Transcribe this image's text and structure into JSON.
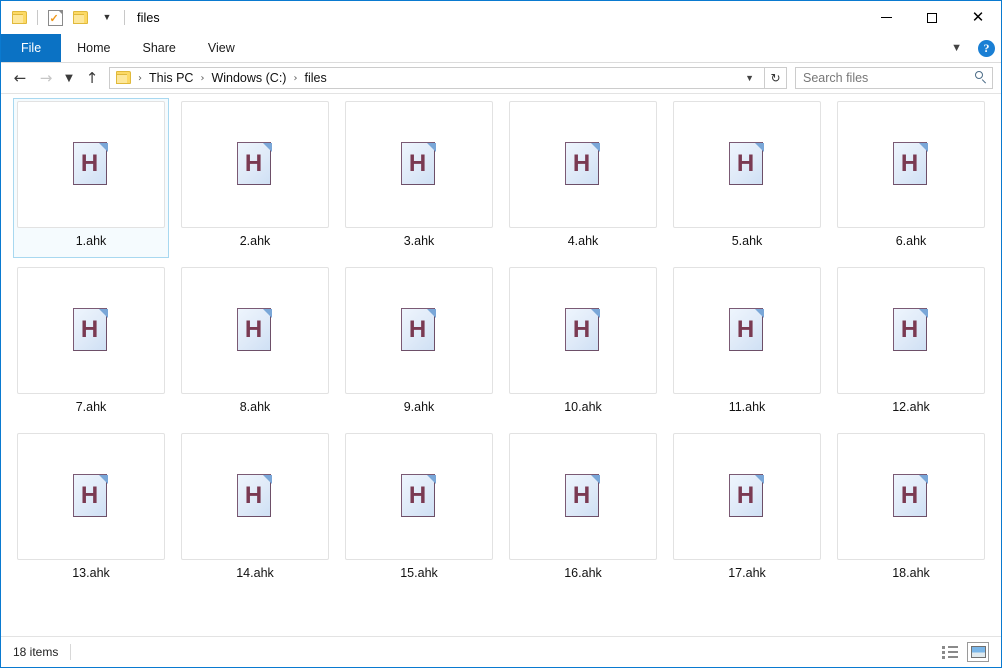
{
  "window": {
    "title": "files",
    "border_color": "#0a7ad0"
  },
  "quick_access": {
    "folder_icon": "folder-icon",
    "properties_icon": "properties-icon",
    "new_folder_icon": "new-folder-icon",
    "customize_icon": "chevron-down-icon"
  },
  "window_controls": {
    "minimize": "minimize-icon",
    "maximize": "maximize-icon",
    "close": "close-icon"
  },
  "ribbon": {
    "tabs": [
      {
        "label": "File",
        "selected": true
      },
      {
        "label": "Home",
        "selected": false
      },
      {
        "label": "Share",
        "selected": false
      },
      {
        "label": "View",
        "selected": false
      }
    ],
    "expand_icon": "chevron-down-icon",
    "help_label": "?",
    "accent_color": "#0b72c4"
  },
  "address_bar": {
    "back_icon": "back-arrow-icon",
    "forward_icon": "forward-arrow-icon",
    "recent_icon": "chevron-down-icon",
    "up_icon": "up-arrow-icon",
    "breadcrumb": [
      {
        "label": "This PC"
      },
      {
        "label": "Windows (C:)"
      },
      {
        "label": "files"
      }
    ],
    "breadcrumb_folder_icon": "folder-icon",
    "breadcrumb_dropdown_icon": "chevron-down-icon",
    "refresh_icon": "refresh-icon"
  },
  "search": {
    "placeholder": "Search files",
    "value": "",
    "icon": "search-icon"
  },
  "files": [
    {
      "name": "1.ahk",
      "selected": true
    },
    {
      "name": "2.ahk",
      "selected": false
    },
    {
      "name": "3.ahk",
      "selected": false
    },
    {
      "name": "4.ahk",
      "selected": false
    },
    {
      "name": "5.ahk",
      "selected": false
    },
    {
      "name": "6.ahk",
      "selected": false
    },
    {
      "name": "7.ahk",
      "selected": false
    },
    {
      "name": "8.ahk",
      "selected": false
    },
    {
      "name": "9.ahk",
      "selected": false
    },
    {
      "name": "10.ahk",
      "selected": false
    },
    {
      "name": "11.ahk",
      "selected": false
    },
    {
      "name": "12.ahk",
      "selected": false
    },
    {
      "name": "13.ahk",
      "selected": false
    },
    {
      "name": "14.ahk",
      "selected": false
    },
    {
      "name": "15.ahk",
      "selected": false
    },
    {
      "name": "16.ahk",
      "selected": false
    },
    {
      "name": "17.ahk",
      "selected": false
    },
    {
      "name": "18.ahk",
      "selected": false
    }
  ],
  "file_icon": {
    "letter": "H",
    "letter_color": "#7a3a52",
    "page_color": "#e3eefa"
  },
  "status_bar": {
    "item_count": "18 items",
    "details_view_icon": "details-view-icon",
    "large_icons_view_icon": "large-icons-view-icon",
    "active_view": "large-icons"
  }
}
